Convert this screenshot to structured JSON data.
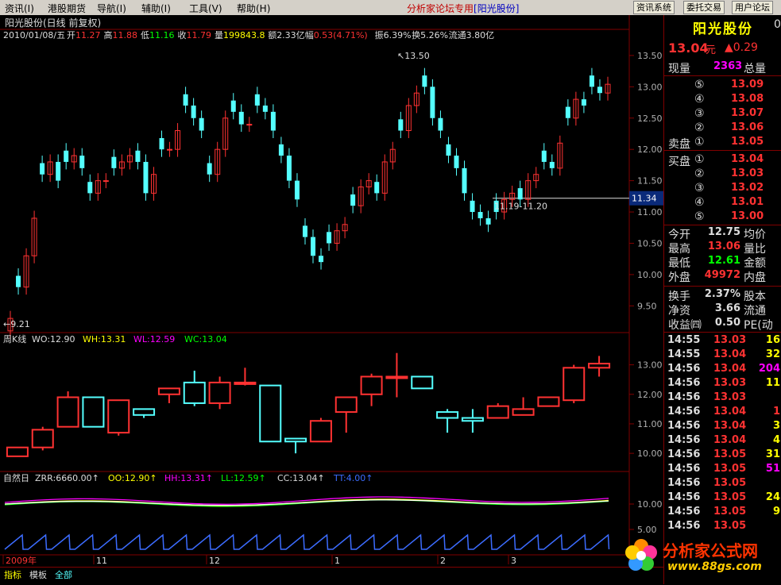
{
  "menu": [
    "资讯(I)",
    "港股期货",
    "导航(I)",
    "辅助(I)",
    "工具(V)",
    "帮助(H)"
  ],
  "banner": {
    "text": "分析家论坛专用",
    "stock": "[阳光股份]"
  },
  "toolbar_buttons": [
    "资讯系统",
    "委托交易",
    "用户论坛"
  ],
  "colors": {
    "up": "#ff3232",
    "down": "#54ffff",
    "grid": "#800000",
    "yellow": "#ffff00",
    "white": "#ffffff",
    "magenta": "#ff00ff",
    "green": "#00ff00"
  },
  "main_chart": {
    "title": "阳光股份(日线 前复权)",
    "info_date": "2010/01/08/五",
    "info": [
      {
        "label": "开",
        "value": "11.27",
        "color": "#ff3232"
      },
      {
        "label": "高",
        "value": "11.88",
        "color": "#ff3232"
      },
      {
        "label": "低",
        "value": "11.16",
        "color": "#00ff00"
      },
      {
        "label": "收",
        "value": "11.79",
        "color": "#ff3232"
      },
      {
        "label": "量",
        "value": "199843.8",
        "color": "#ffff00"
      },
      {
        "label": "额",
        "value": "2.33亿",
        "color": "#dddddd"
      },
      {
        "label": "幅",
        "value": "0.53(4.71%)",
        "color": "#ff3232"
      },
      {
        "label": "振",
        "value": "6.39%",
        "color": "#dddddd"
      },
      {
        "label": "换",
        "value": "5.26%",
        "color": "#dddddd"
      },
      {
        "label": "流通",
        "value": "3.80亿",
        "color": "#dddddd"
      }
    ],
    "y_ticks": [
      "13.50",
      "13.00",
      "12.50",
      "12.00",
      "11.50",
      "11.00",
      "10.50",
      "10.00",
      "9.50"
    ],
    "current_price_tag": "11.34",
    "annotation_high": "13.50",
    "annotation_low": "9.21",
    "annotation_range": "11.19-11.20"
  },
  "weekly_panel": {
    "title": "周K线",
    "items": [
      {
        "label": "WO:12.90",
        "color": "#dddddd"
      },
      {
        "label": "WH:13.31",
        "color": "#ffff00"
      },
      {
        "label": "WL:12.59",
        "color": "#ff00ff"
      },
      {
        "label": "WC:13.04",
        "color": "#00ff00"
      }
    ],
    "y_ticks": [
      "13.00",
      "12.00",
      "11.00",
      "10.00"
    ]
  },
  "indicator_panel": {
    "title": "自然日",
    "items": [
      {
        "label": "ZRR:6660.00↑",
        "color": "#dddddd"
      },
      {
        "label": "OO:12.90↑",
        "color": "#ffff00"
      },
      {
        "label": "HH:13.31↑",
        "color": "#ff00ff"
      },
      {
        "label": "LL:12.59↑",
        "color": "#00ff00"
      },
      {
        "label": "CC:13.04↑",
        "color": "#dddddd"
      },
      {
        "label": "TT:4.00↑",
        "color": "#3c6cff"
      }
    ],
    "y_ticks": [
      "10.00",
      "5.00"
    ]
  },
  "x_axis": [
    "2009年",
    "11",
    "12",
    "1",
    "2",
    "3"
  ],
  "bottom_tabs": [
    "指标",
    "模板",
    "全部"
  ],
  "quote_panel": {
    "name": "阳光股份",
    "name_suffix": "0",
    "price": "13.04",
    "price_unit": "元",
    "change": "▲0.29",
    "now_volume_label": "现量",
    "now_volume": "2363",
    "total_volume_label": "总量",
    "sell_label": "卖盘",
    "buy_label": "买盘",
    "sells": [
      {
        "idx": "⑤",
        "price": "13.09"
      },
      {
        "idx": "④",
        "price": "13.08"
      },
      {
        "idx": "③",
        "price": "13.07"
      },
      {
        "idx": "②",
        "price": "13.06"
      },
      {
        "idx": "①",
        "price": "13.05"
      }
    ],
    "buys": [
      {
        "idx": "①",
        "price": "13.04"
      },
      {
        "idx": "②",
        "price": "13.03"
      },
      {
        "idx": "③",
        "price": "13.02"
      },
      {
        "idx": "④",
        "price": "13.01"
      },
      {
        "idx": "⑤",
        "price": "13.00"
      }
    ],
    "stats": [
      {
        "l": "今开",
        "v": "12.75",
        "c": "#dddddd",
        "r": "均价"
      },
      {
        "l": "最高",
        "v": "13.06",
        "c": "#ff3232",
        "r": "量比"
      },
      {
        "l": "最低",
        "v": "12.61",
        "c": "#00ff00",
        "r": "金额"
      },
      {
        "l": "外盘",
        "v": "49972",
        "c": "#ff3232",
        "r": "内盘"
      }
    ],
    "stats2": [
      {
        "l": "换手",
        "v": "2.37%",
        "c": "#dddddd",
        "r": "股本"
      },
      {
        "l": "净资",
        "v": "3.66",
        "c": "#dddddd",
        "r": "流通"
      },
      {
        "l": "收益㈣",
        "v": "0.50",
        "c": "#dddddd",
        "r": "PE(动"
      }
    ],
    "ticks": [
      {
        "t": "14:55",
        "p": "13.03",
        "v": "16",
        "pc": "#ff3232",
        "vc": "#ffff00"
      },
      {
        "t": "14:55",
        "p": "13.04",
        "v": "32",
        "pc": "#ff3232",
        "vc": "#ffff00"
      },
      {
        "t": "14:56",
        "p": "13.04",
        "v": "204",
        "pc": "#ff3232",
        "vc": "#ff00ff"
      },
      {
        "t": "14:56",
        "p": "13.03",
        "v": "11",
        "pc": "#ff3232",
        "vc": "#ffff00"
      },
      {
        "t": "14:56",
        "p": "13.03",
        "v": "",
        "pc": "#ff3232",
        "vc": "#ffff00"
      },
      {
        "t": "14:56",
        "p": "13.04",
        "v": "1",
        "pc": "#ff3232",
        "vc": "#ff3232"
      },
      {
        "t": "14:56",
        "p": "13.04",
        "v": "3",
        "pc": "#ff3232",
        "vc": "#ffff00"
      },
      {
        "t": "14:56",
        "p": "13.04",
        "v": "4",
        "pc": "#ff3232",
        "vc": "#ffff00"
      },
      {
        "t": "14:56",
        "p": "13.05",
        "v": "31",
        "pc": "#ff3232",
        "vc": "#ffff00"
      },
      {
        "t": "14:56",
        "p": "13.05",
        "v": "51",
        "pc": "#ff3232",
        "vc": "#ff00ff"
      },
      {
        "t": "14:56",
        "p": "13.05",
        "v": "",
        "pc": "#ff3232",
        "vc": "#ffff00"
      },
      {
        "t": "14:56",
        "p": "13.05",
        "v": "24",
        "pc": "#ff3232",
        "vc": "#ffff00"
      },
      {
        "t": "14:56",
        "p": "13.05",
        "v": "9",
        "pc": "#ff3232",
        "vc": "#ffff00"
      },
      {
        "t": "14:56",
        "p": "13.05",
        "v": "",
        "pc": "#ff3232",
        "vc": "#ffff00"
      }
    ]
  },
  "logo": {
    "text": "分析家公式网",
    "url": "www.88gs.com"
  },
  "chart_data": {
    "type": "candlestick",
    "daily_close_approx": [
      9.3,
      9.8,
      10.3,
      10.9,
      11.6,
      11.8,
      11.5,
      11.8,
      11.9,
      11.7,
      11.3,
      11.5,
      11.5,
      11.7,
      11.8,
      11.9,
      11.8,
      11.3,
      11.6,
      12.0,
      12.0,
      12.3,
      12.7,
      12.5,
      12.3,
      11.6,
      12.0,
      12.5,
      12.6,
      12.4,
      12.4,
      12.7,
      12.6,
      12.3,
      11.9,
      11.5,
      11.2,
      10.6,
      10.3,
      10.2,
      10.5,
      10.7,
      10.8,
      11.1,
      11.4,
      11.5,
      11.3,
      11.8,
      12.0,
      12.3,
      12.7,
      12.9,
      13.0,
      12.5,
      12.3,
      11.9,
      11.7,
      11.3,
      11.0,
      10.9,
      10.8,
      11.0,
      11.2,
      11.3,
      11.2,
      11.5,
      11.6,
      11.8,
      11.7,
      12.1,
      12.5,
      12.8,
      12.7,
      13.0,
      12.9,
      13.04
    ],
    "weekly_ohlc": [
      [
        9.9,
        10.2,
        9.9,
        10.2
      ],
      [
        10.2,
        10.9,
        10.1,
        10.8
      ],
      [
        10.9,
        12.1,
        10.9,
        11.9
      ],
      [
        11.9,
        11.9,
        10.9,
        10.9
      ],
      [
        10.7,
        11.8,
        10.6,
        11.8
      ],
      [
        11.5,
        11.5,
        11.2,
        11.3
      ],
      [
        12.0,
        12.2,
        11.7,
        12.2
      ],
      [
        12.4,
        12.8,
        11.6,
        11.7
      ],
      [
        11.7,
        12.6,
        11.5,
        12.4
      ],
      [
        12.4,
        12.9,
        12.3,
        12.4
      ],
      [
        12.3,
        12.3,
        10.4,
        10.4
      ],
      [
        10.5,
        10.5,
        10.0,
        10.4
      ],
      [
        10.4,
        11.2,
        10.4,
        11.1
      ],
      [
        11.4,
        11.9,
        10.7,
        11.9
      ],
      [
        12.0,
        12.7,
        11.6,
        12.6
      ],
      [
        12.6,
        13.4,
        11.9,
        12.6
      ],
      [
        12.6,
        12.5,
        12.4,
        12.2
      ],
      [
        11.4,
        11.5,
        10.7,
        11.2
      ],
      [
        11.2,
        11.5,
        10.7,
        11.1
      ],
      [
        11.2,
        11.7,
        11.3,
        11.6
      ],
      [
        11.3,
        11.9,
        11.3,
        11.5
      ],
      [
        11.6,
        11.9,
        11.6,
        11.9
      ],
      [
        11.8,
        13.0,
        11.7,
        12.9
      ],
      [
        12.9,
        13.3,
        12.6,
        13.04
      ]
    ],
    "y_range_main": [
      9.2,
      13.6
    ],
    "y_range_weekly": [
      9.6,
      13.5
    ]
  }
}
